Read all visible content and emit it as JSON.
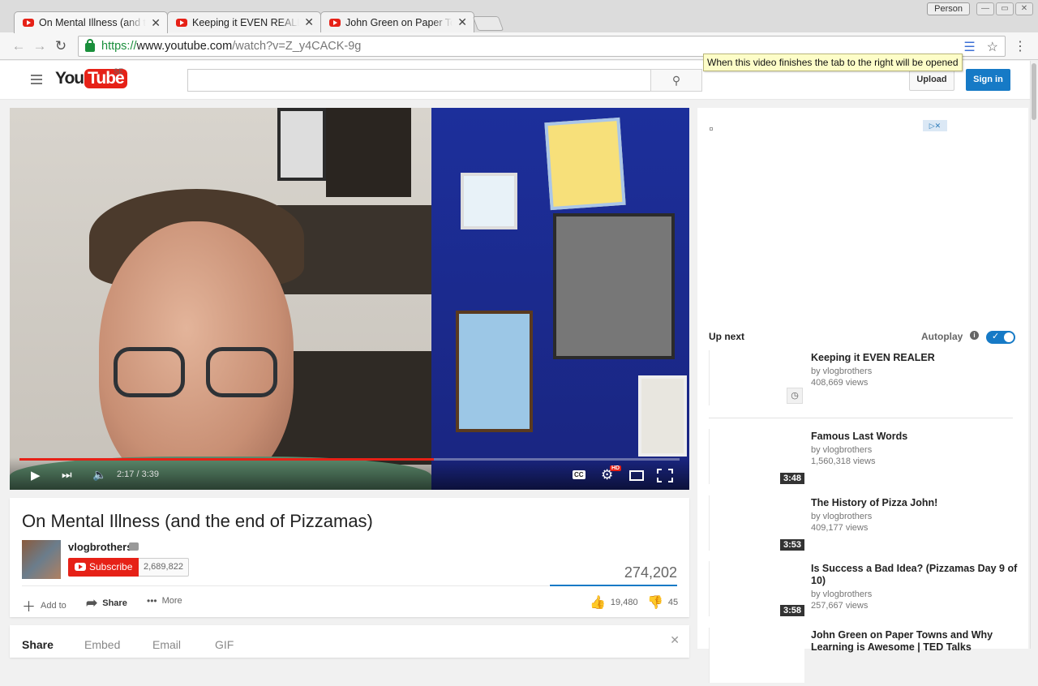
{
  "browser": {
    "tabs": [
      {
        "label": "On Mental Illness (and the end of Pizzamas)"
      },
      {
        "label": "Keeping it EVEN REALER - YouTube"
      },
      {
        "label": "John Green on Paper Towns and Why Learning"
      }
    ],
    "person_label": "Person",
    "url_scheme": "https://",
    "url_host": "www.youtube.com",
    "url_path": "/watch?v=Z_y4CACK-9g",
    "tooltip": "When this video finishes the tab to the right will be opened"
  },
  "header": {
    "logo_you": "You",
    "logo_tube": "Tube",
    "country": "SE",
    "search_placeholder": "",
    "upload_label": "Upload",
    "signin_label": "Sign in"
  },
  "player": {
    "time": "2:17 / 3:39",
    "progress_fraction": 0.628,
    "cc_label": "CC",
    "hd_label": "HD"
  },
  "video": {
    "title": "On Mental Illness (and the end of Pizzamas)",
    "channel": "vlogbrothers",
    "subscribe_label": "Subscribe",
    "subscriber_count": "2,689,822",
    "views": "274,202",
    "add_to_label": "Add to",
    "share_label": "Share",
    "more_label": "More",
    "likes": "19,480",
    "dislikes": "45"
  },
  "share_panel": {
    "tabs": [
      "Share",
      "Embed",
      "Email",
      "GIF"
    ]
  },
  "sidebar": {
    "up_next_label": "Up next",
    "autoplay_label": "Autoplay",
    "items": [
      {
        "title": "Keeping it EVEN REALER",
        "channel": "by vlogbrothers",
        "views": "408,669 views",
        "duration": ""
      },
      {
        "title": "Famous Last Words",
        "channel": "by vlogbrothers",
        "views": "1,560,318 views",
        "duration": "3:48"
      },
      {
        "title": "The History of Pizza John!",
        "channel": "by vlogbrothers",
        "views": "409,177 views",
        "duration": "3:53"
      },
      {
        "title": "Is Success a Bad Idea? (Pizzamas Day 9 of 10)",
        "channel": "by vlogbrothers",
        "views": "257,667 views",
        "duration": "3:58"
      },
      {
        "title": "John Green on Paper Towns and Why Learning is Awesome | TED Talks",
        "channel": "",
        "views": "",
        "duration": ""
      }
    ]
  }
}
